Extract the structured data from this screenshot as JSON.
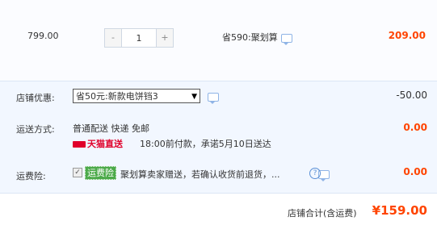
{
  "item": {
    "unit_price": "799.00",
    "quantity": "1",
    "minus_label": "-",
    "plus_label": "+",
    "saving": "省590:聚划算",
    "total": "209.00"
  },
  "shop_discount": {
    "label": "店铺优惠:",
    "selected_coupon": "省50元:新款电饼铛3",
    "amount": "-50.00"
  },
  "shipping": {
    "label": "运送方式:",
    "method": "普通配送 快递 免邮",
    "tmall_tag": "天猫直送",
    "desc": "18:00前付款，承诺5月10日送达",
    "amount": "0.00"
  },
  "insurance": {
    "label": "运费险:",
    "badge": "运费险",
    "text": "聚划算卖家赠送，若确认收货前退货，...",
    "help": "?",
    "amount": "0.00"
  },
  "summary": {
    "label": "店铺合计(含运费)",
    "amount": "¥159.00"
  },
  "colors": {
    "price_red": "#ff4400",
    "row_bg": "#f2f7ff",
    "badge_green": "#4caa4a"
  }
}
